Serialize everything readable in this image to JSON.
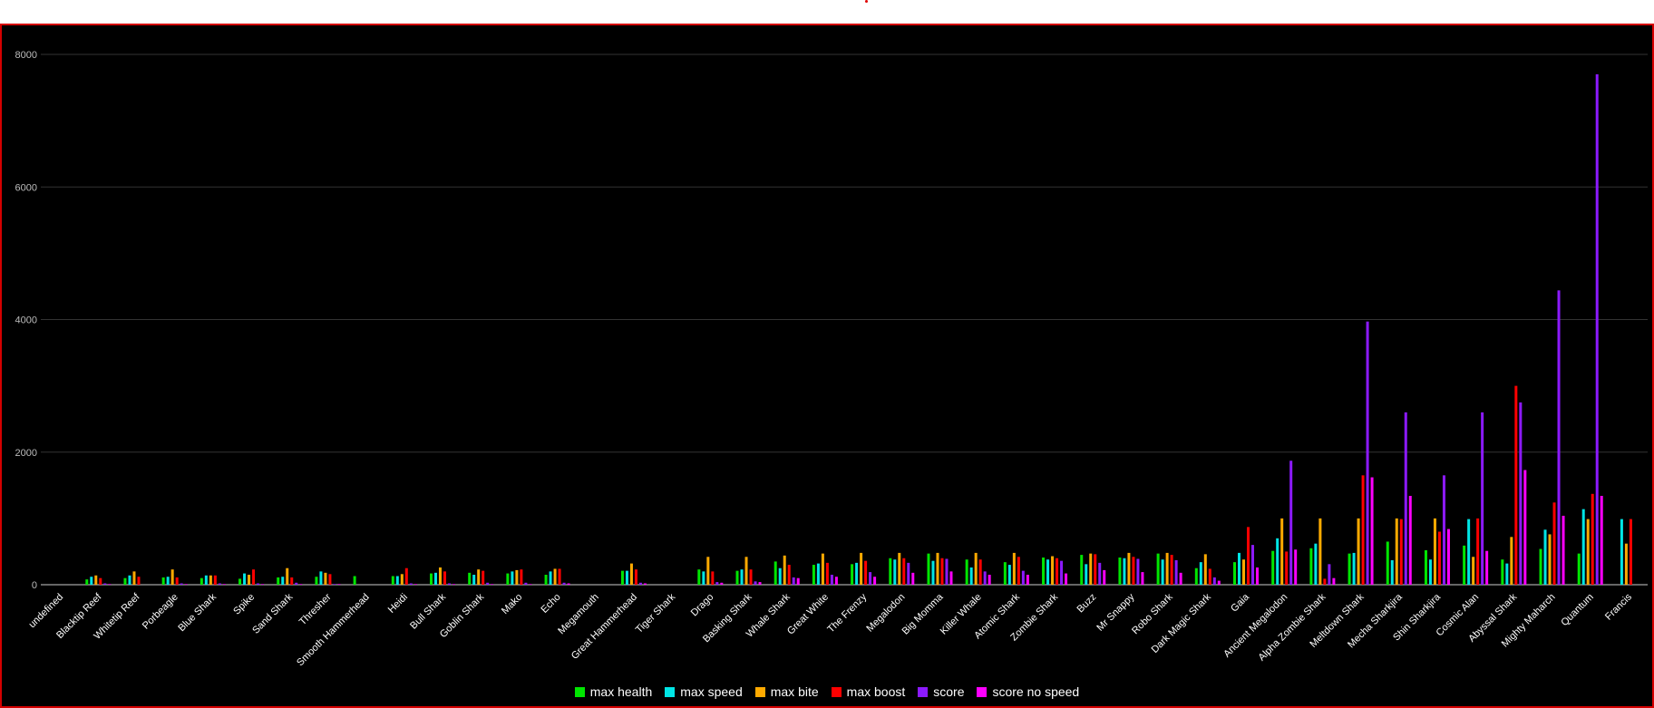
{
  "chart_data": {
    "type": "bar",
    "title": "",
    "xlabel": "",
    "ylabel": "",
    "ylim": [
      0,
      8000
    ],
    "yticks": [
      "0",
      "2000",
      "4000",
      "6000",
      "8000"
    ],
    "grid": true,
    "legend_position": "bottom-center",
    "categories": [
      "undefined",
      "Blacktip Reef",
      "Whitetip Reef",
      "Porbeagle",
      "Blue Shark",
      "Spike",
      "Sand Shark",
      "Thresher",
      "Smooth Hammerhead",
      "Heidi",
      "Bull Shark",
      "Goblin Shark",
      "Mako",
      "Echo",
      "Megamouth",
      "Great Hammerhead",
      "Tiger Shark",
      "Drago",
      "Basking Shark",
      "Whale Shark",
      "Great White",
      "The Frenzy",
      "Megalodon",
      "Big Momma",
      "Killer Whale",
      "Atomic Shark",
      "Zombie Shark",
      "Buzz",
      "Mr Snappy",
      "Robo Shark",
      "Dark Magic Shark",
      "Gaia",
      "Ancient Megalodon",
      "Alpha Zombie Shark",
      "Meltdown Shark",
      "Mecha Sharkjira",
      "Shin Sharkjira",
      "Cosmic Alan",
      "Abyssal Shark",
      "Mighty Maharch",
      "Quantum",
      "Francis"
    ],
    "series": [
      {
        "name": "max health",
        "color": "#00e600",
        "values": [
          0,
          80,
          100,
          110,
          100,
          90,
          110,
          120,
          130,
          130,
          170,
          180,
          170,
          150,
          0,
          210,
          0,
          230,
          210,
          350,
          300,
          310,
          400,
          470,
          380,
          340,
          410,
          450,
          410,
          470,
          250,
          340,
          510,
          550,
          470,
          650,
          520,
          590,
          380,
          540,
          470,
          0
        ]
      },
      {
        "name": "max speed",
        "color": "#00e5e5",
        "values": [
          0,
          120,
          140,
          120,
          140,
          170,
          120,
          200,
          0,
          130,
          180,
          150,
          200,
          200,
          0,
          210,
          0,
          200,
          230,
          250,
          320,
          330,
          380,
          360,
          260,
          300,
          380,
          310,
          400,
          380,
          340,
          480,
          700,
          620,
          480,
          370,
          380,
          990,
          320,
          830,
          1140,
          990
        ]
      },
      {
        "name": "max bite",
        "color": "#ffaa00",
        "values": [
          0,
          140,
          200,
          230,
          140,
          150,
          250,
          180,
          0,
          160,
          260,
          230,
          220,
          240,
          0,
          320,
          0,
          420,
          420,
          440,
          470,
          480,
          480,
          480,
          480,
          480,
          430,
          470,
          480,
          480,
          460,
          380,
          1000,
          1000,
          1000,
          1000,
          1000,
          420,
          720,
          760,
          990,
          620
        ]
      },
      {
        "name": "max boost",
        "color": "#ff0000",
        "values": [
          0,
          100,
          120,
          110,
          140,
          230,
          110,
          160,
          0,
          250,
          200,
          210,
          230,
          240,
          0,
          230,
          0,
          200,
          230,
          300,
          330,
          360,
          400,
          400,
          380,
          420,
          400,
          460,
          420,
          450,
          240,
          870,
          500,
          90,
          1650,
          990,
          800,
          1000,
          3000,
          1240,
          1370,
          990
        ]
      },
      {
        "name": "score",
        "color": "#8c1aff",
        "values": [
          0,
          20,
          0,
          20,
          20,
          20,
          30,
          10,
          0,
          20,
          20,
          30,
          30,
          30,
          0,
          30,
          0,
          40,
          50,
          110,
          150,
          190,
          330,
          390,
          200,
          210,
          360,
          330,
          390,
          370,
          110,
          600,
          1870,
          310,
          3970,
          2600,
          1650,
          2600,
          2750,
          4440,
          7700,
          0
        ]
      },
      {
        "name": "score no speed",
        "color": "#ff00ff",
        "values": [
          0,
          10,
          0,
          10,
          10,
          10,
          10,
          10,
          0,
          10,
          10,
          10,
          10,
          20,
          0,
          20,
          0,
          30,
          40,
          100,
          120,
          120,
          180,
          200,
          150,
          150,
          170,
          220,
          190,
          180,
          60,
          260,
          530,
          100,
          1620,
          1340,
          840,
          510,
          1730,
          1040,
          1340,
          0
        ]
      }
    ]
  }
}
